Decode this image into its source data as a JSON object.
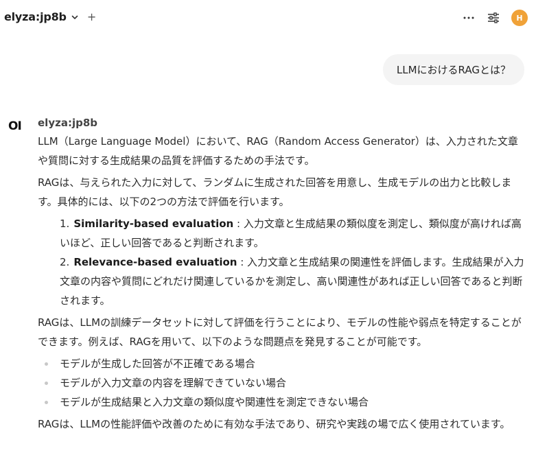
{
  "header": {
    "model_name": "elyza:jp8b",
    "add_label": "+",
    "avatar_initial": "H"
  },
  "user_message": "LLMにおけるRAGとは？",
  "assistant": {
    "logo": "OI",
    "name": "elyza:jp8b",
    "paragraph1": "LLM（Large Language Model）において、RAG（Random Access Generator）は、入力された文章や質問に対する生成結果の品質を評価するための手法です。",
    "paragraph2": "RAGは、与えられた入力に対して、ランダムに生成された回答を用意し、生成モデルの出力と比較します。具体的には、以下の2つの方法で評価を行います。",
    "ordered": [
      {
        "num": "1.",
        "title": "Similarity-based evaluation",
        "text": " : 入力文章と生成結果の類似度を測定し、類似度が高ければ高いほど、正しい回答であると判断されます。"
      },
      {
        "num": "2.",
        "title": "Relevance-based evaluation",
        "text": " : 入力文章と生成結果の関連性を評価します。生成結果が入力文章の内容や質問にどれだけ関連しているかを測定し、高い関連性があれば正しい回答であると判断されます。"
      }
    ],
    "paragraph3": "RAGは、LLMの訓練データセットに対して評価を行うことにより、モデルの性能や弱点を特定することができます。例えば、RAGを用いて、以下のような問題点を発見することが可能です。",
    "bullets": [
      "モデルが生成した回答が不正確である場合",
      "モデルが入力文章の内容を理解できていない場合",
      "モデルが生成結果と入力文章の類似度や関連性を測定できない場合"
    ],
    "paragraph4": "RAGは、LLMの性能評価や改善のために有効な手法であり、研究や実践の場で広く使用されています。"
  },
  "colors": {
    "avatar": "#f0a238",
    "user_bubble": "#f4f4f4",
    "bullet": "#c8c8c8"
  }
}
